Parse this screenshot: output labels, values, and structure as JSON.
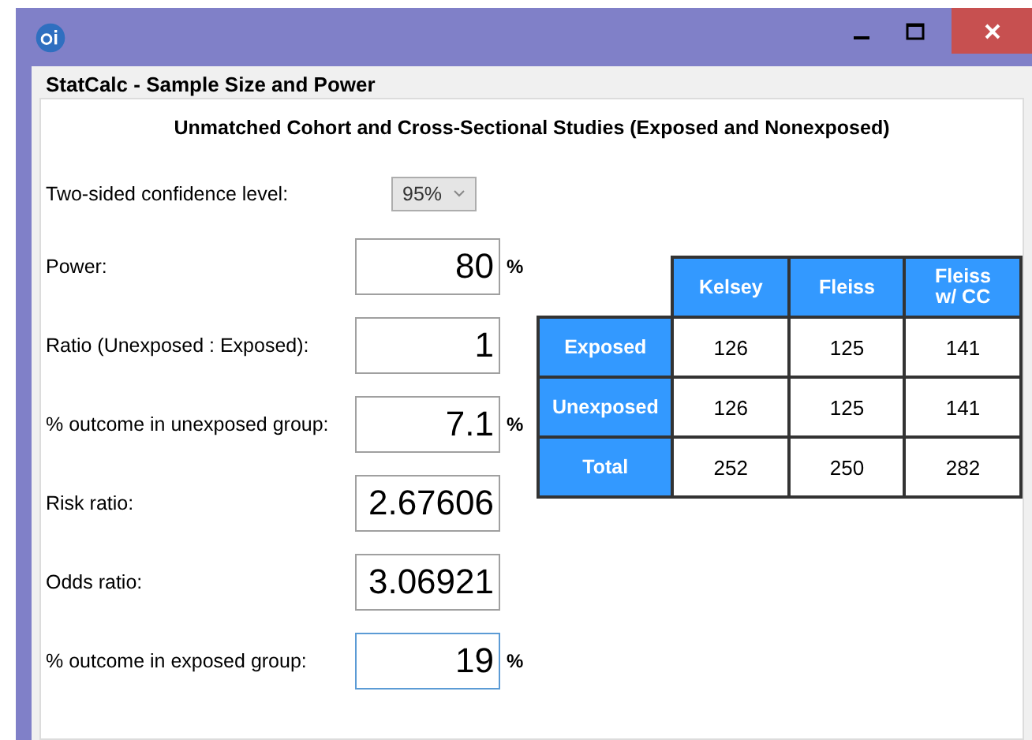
{
  "window": {
    "title": "StatCalc - Sample Size and Power"
  },
  "heading": "Unmatched Cohort and Cross-Sectional Studies (Exposed and Nonexposed)",
  "confidence": {
    "label": "Two-sided confidence level:",
    "value": "95%"
  },
  "fields": [
    {
      "label": "Power:",
      "value": "80",
      "unit": "%",
      "focused": false
    },
    {
      "label": "Ratio (Unexposed : Exposed):",
      "value": "1",
      "focused": false
    },
    {
      "label": "% outcome in unexposed group:",
      "value": "7.1",
      "unit": "%",
      "focused": false
    },
    {
      "label": "Risk ratio:",
      "value": "2.67606",
      "focused": false
    },
    {
      "label": "Odds ratio:",
      "value": "3.06921",
      "focused": false
    },
    {
      "label": "% outcome in exposed group:",
      "value": "19",
      "unit": "%",
      "focused": true
    }
  ],
  "table": {
    "columns": [
      "Kelsey",
      "Fleiss",
      "Fleiss\nw/ CC"
    ],
    "rows": [
      {
        "label": "Exposed",
        "cells": [
          "126",
          "125",
          "141"
        ]
      },
      {
        "label": "Unexposed",
        "cells": [
          "126",
          "125",
          "141"
        ]
      },
      {
        "label": "Total",
        "cells": [
          "252",
          "250",
          "282"
        ]
      }
    ]
  }
}
